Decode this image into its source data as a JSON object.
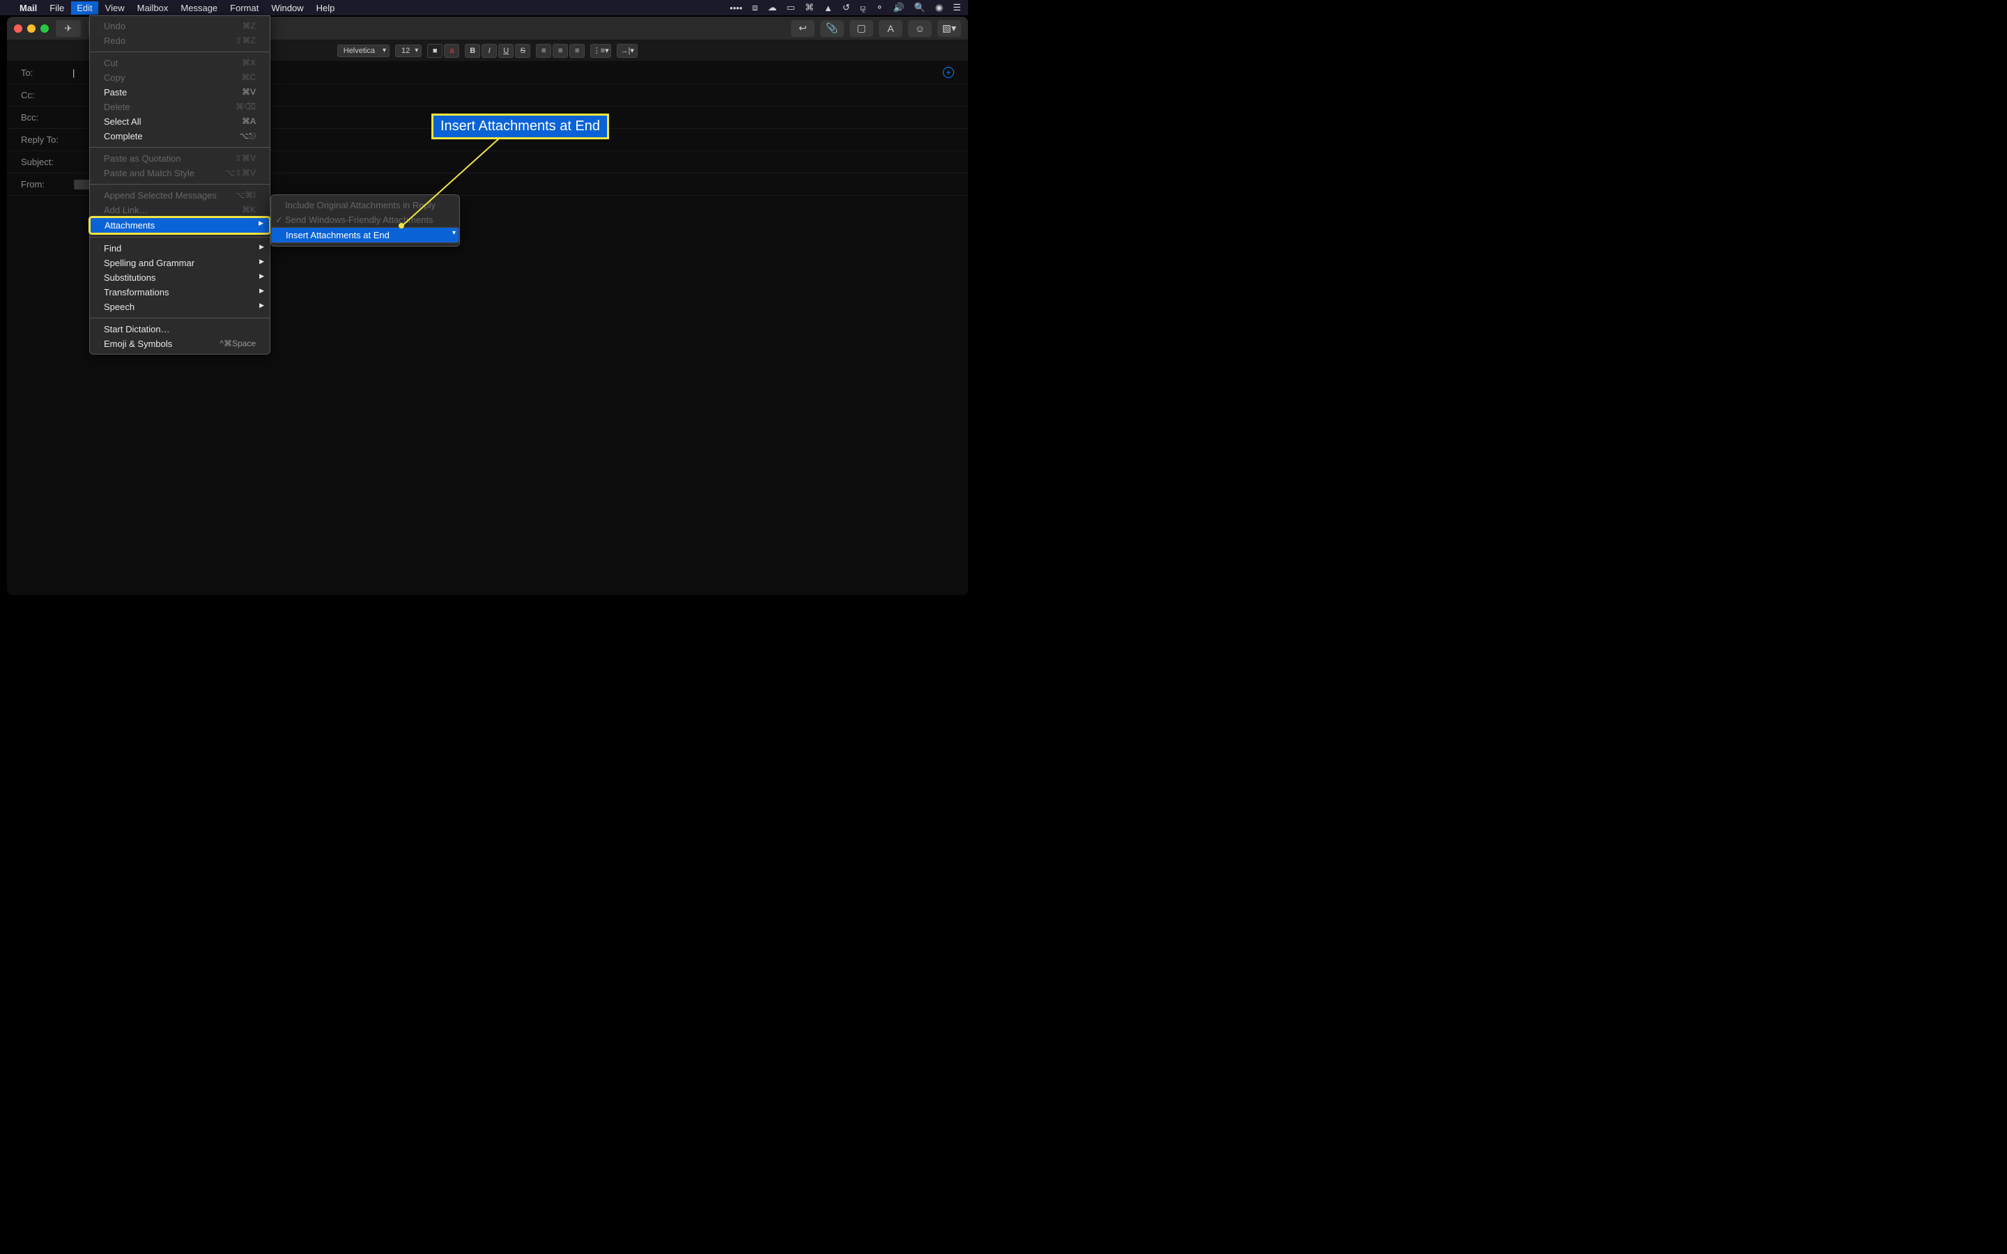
{
  "menubar": {
    "app": "Mail",
    "items": [
      "File",
      "Edit",
      "View",
      "Mailbox",
      "Message",
      "Format",
      "Window",
      "Help"
    ]
  },
  "callout": "Insert Attachments at End",
  "edit_menu": {
    "undo": {
      "label": "Undo",
      "sc": "⌘Z"
    },
    "redo": {
      "label": "Redo",
      "sc": "⇧⌘Z"
    },
    "cut": {
      "label": "Cut",
      "sc": "⌘X"
    },
    "copy": {
      "label": "Copy",
      "sc": "⌘C"
    },
    "paste": {
      "label": "Paste",
      "sc": "⌘V"
    },
    "delete": {
      "label": "Delete",
      "sc": "⌘⌫"
    },
    "select_all": {
      "label": "Select All",
      "sc": "⌘A"
    },
    "complete": {
      "label": "Complete",
      "sc": "⌥⎋"
    },
    "paste_quote": {
      "label": "Paste as Quotation",
      "sc": "⇧⌘V"
    },
    "paste_match": {
      "label": "Paste and Match Style",
      "sc": "⌥⇧⌘V"
    },
    "append_sel": {
      "label": "Append Selected Messages",
      "sc": "⌥⌘I"
    },
    "add_link": {
      "label": "Add Link…",
      "sc": "⌘K"
    },
    "attachments": {
      "label": "Attachments"
    },
    "find": {
      "label": "Find"
    },
    "spelling": {
      "label": "Spelling and Grammar"
    },
    "subs": {
      "label": "Substitutions"
    },
    "trans": {
      "label": "Transformations"
    },
    "speech": {
      "label": "Speech"
    },
    "dictation": {
      "label": "Start Dictation…"
    },
    "emoji": {
      "label": "Emoji & Symbols",
      "sc": "^⌘Space"
    }
  },
  "submenu": {
    "include_orig": "Include Original Attachments in Reply",
    "windows_friendly": "Send Windows-Friendly Attachments",
    "insert_end": "Insert Attachments at End"
  },
  "compose": {
    "font": "Helvetica",
    "size": "12",
    "fields": {
      "to": "To:",
      "cc": "Cc:",
      "bcc": "Bcc:",
      "reply_to": "Reply To:",
      "subject": "Subject:",
      "from": "From:"
    }
  }
}
